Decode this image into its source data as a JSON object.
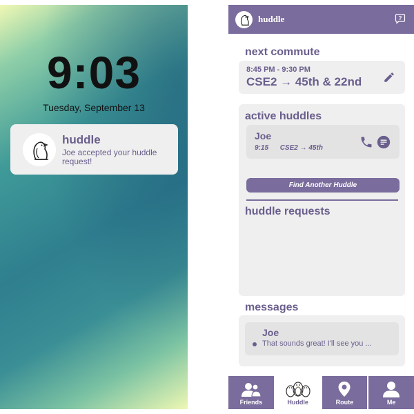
{
  "lock_screen": {
    "time": "9:03",
    "date": "Tuesday, September 13",
    "notification": {
      "app_name": "huddle",
      "message": "Joe accepted your huddle request!",
      "icon": "penguin-logo-icon"
    }
  },
  "app": {
    "header": {
      "title": "huddle",
      "logo_icon": "penguin-logo-icon",
      "help_icon": "help-icon"
    },
    "next_commute": {
      "title": "next commute",
      "time_range": "8:45 PM - 9:30 PM",
      "route": "CSE2 → 45th & 22nd",
      "edit_icon": "pencil-icon"
    },
    "active_huddles": {
      "title": "active huddles",
      "items": [
        {
          "name": "Joe",
          "time": "9:15",
          "route": "CSE2 → 45th"
        }
      ],
      "find_button": "Find Another Huddle"
    },
    "huddle_requests": {
      "title": "huddle requests"
    },
    "messages": {
      "title": "messages",
      "items": [
        {
          "name": "Joe",
          "preview": "That sounds great! I'll see you ..."
        }
      ]
    },
    "tabs": [
      {
        "label": "Friends",
        "icon": "friends-icon",
        "active": false
      },
      {
        "label": "Huddle",
        "icon": "penguins-icon",
        "active": true
      },
      {
        "label": "Route",
        "icon": "map-pin-icon",
        "active": false
      },
      {
        "label": "Me",
        "icon": "person-icon",
        "active": false
      }
    ]
  },
  "colors": {
    "brand_purple": "#7a6c9c",
    "text_purple": "#6a5e8d",
    "card_gray": "#efefef",
    "inner_card_gray": "#e3e3e3"
  }
}
